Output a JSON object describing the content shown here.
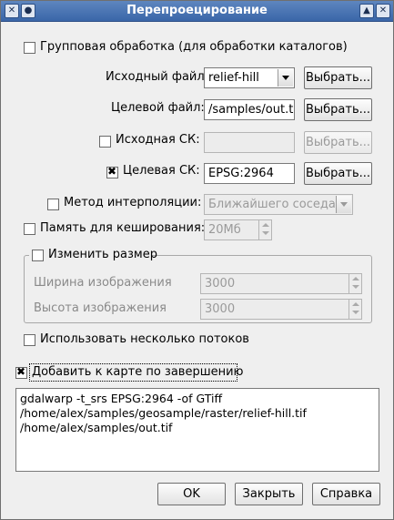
{
  "window": {
    "title": "Перепроецирование",
    "buttons": [
      "▲",
      "✕"
    ]
  },
  "batch_checkbox": {
    "label": "Групповая обработка (для обработки каталогов)",
    "checked": false
  },
  "source_file": {
    "label": "Исходный файл:",
    "value": "relief-hill",
    "browse_label": "Выбрать..."
  },
  "target_file": {
    "label": "Целевой файл:",
    "value": "/samples/out.tif",
    "browse_label": "Выбрать..."
  },
  "source_srs": {
    "label": "Исходная СК:",
    "checked": false,
    "value": "",
    "browse_label": "Выбрать..."
  },
  "target_srs": {
    "label": "Целевая СК:",
    "checked": true,
    "value": "EPSG:2964",
    "browse_label": "Выбрать..."
  },
  "resampling": {
    "label": "Метод интерполяции:",
    "checked": false,
    "value": "Ближайшего соседа"
  },
  "cache": {
    "label": "Память для кеширования:",
    "checked": false,
    "value": "20Мб"
  },
  "resize": {
    "label": "Изменить размер",
    "checked": false,
    "width_label": "Ширина изображения",
    "width_value": "3000",
    "height_label": "Высота изображения",
    "height_value": "3000"
  },
  "multithread": {
    "label": "Использовать несколько потоков",
    "checked": false
  },
  "add_to_map": {
    "label": "Добавить к карте по завершению",
    "checked": true
  },
  "command": {
    "line1": "gdalwarp -t_srs EPSG:2964 -of GTiff",
    "line2": "/home/alex/samples/geosample/raster/relief-hill.tif",
    "line3": "/home/alex/samples/out.tif"
  },
  "footer": {
    "ok_label": "OK",
    "close_label": "Закрыть",
    "help_label": "Справка"
  },
  "colors": {
    "titlebar": "#3a66a8",
    "window_bg": "#efefef"
  }
}
